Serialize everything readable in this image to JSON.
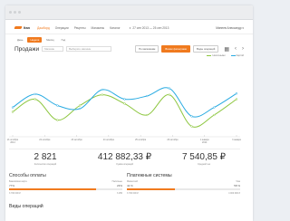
{
  "nav": {
    "logo": "Itan",
    "items": [
      "Дашборд",
      "Операции",
      "Рецепты",
      "Магазины",
      "Каталог"
    ],
    "active_index": 0,
    "date_range": "27 сен 2013 — 25 сен 2013",
    "user": "Минеев Александр"
  },
  "tabs": [
    "День",
    "Неделя",
    "Месяц",
    "Год"
  ],
  "active_tab": 1,
  "sales": {
    "title": "Продажи",
    "filter1": "Магазин",
    "filter2": "Выберите магазин",
    "buttons": [
      "По магазинам",
      "Всеми фильтрами",
      "Виды операций"
    ],
    "active_button": 1
  },
  "legend": {
    "green": "Наличными",
    "blue": "Картой",
    "colors": {
      "green": "#8dc63f",
      "blue": "#29abe2"
    }
  },
  "chart_data": {
    "type": "line",
    "categories": [
      "21 октября",
      "22 октября",
      "23 октября",
      "24 октября",
      "25 октября",
      "26 октября",
      "1 января",
      "3 января"
    ],
    "category_sub": [
      "2014",
      "",
      "",
      "",
      "",
      "",
      "2014",
      ""
    ],
    "series": [
      {
        "name": "Наличными",
        "color": "#8dc63f",
        "values": [
          35,
          55,
          22,
          45,
          62,
          48,
          30,
          62,
          12,
          30,
          55
        ]
      },
      {
        "name": "Картой",
        "color": "#29abe2",
        "values": [
          42,
          63,
          45,
          40,
          70,
          55,
          60,
          72,
          28,
          42,
          64
        ]
      }
    ],
    "ylim": [
      0,
      100
    ]
  },
  "stats": [
    {
      "value": "2 821",
      "label": "Количество операций"
    },
    {
      "value": "412 882,33 ₽",
      "label": "Сумма операций"
    },
    {
      "value": "7 540,85 ₽",
      "label": "Средний чек"
    }
  ],
  "payment": {
    "title": "Способы оплаты",
    "sub_left": "Банковская карта",
    "sub_right": "Наличные",
    "pct_left": "77%",
    "pct_right": "23%",
    "fill": 0.77,
    "bottom_left": "3 700 000 ₽",
    "bottom_right": "3 256"
  },
  "systems": {
    "title": "Платежные системы",
    "sub_left": "Mastercard",
    "sub_right": "Visa",
    "pct_left": "42 %",
    "pct_right": "58 %",
    "fill": 0.42,
    "bottom_left": "3 700 000 ₽",
    "bottom_right": "4 000 000 ₽"
  },
  "ops_title": "Виды операций"
}
